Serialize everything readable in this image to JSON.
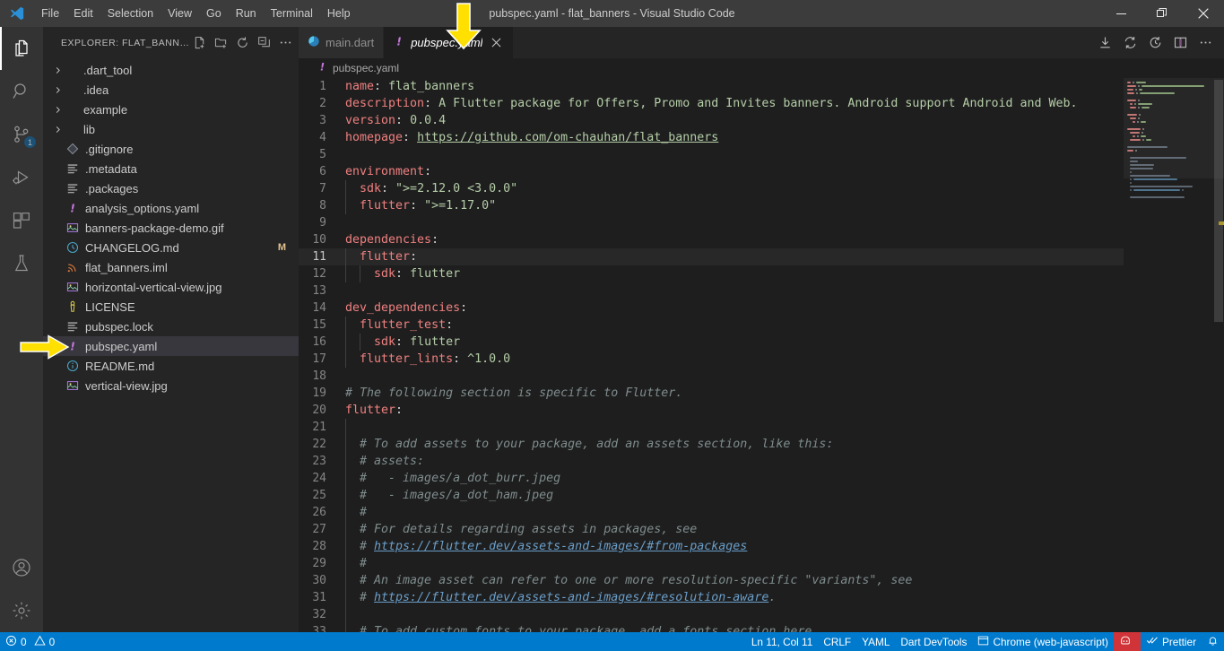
{
  "window": {
    "title": "pubspec.yaml - flat_banners - Visual Studio Code",
    "minimize_label": "Minimize",
    "restore_label": "Restore",
    "close_label": "Close"
  },
  "menu": {
    "items": [
      "File",
      "Edit",
      "Selection",
      "View",
      "Go",
      "Run",
      "Terminal",
      "Help"
    ]
  },
  "activitybar": {
    "items": [
      {
        "name": "explorer",
        "icon": "files-icon",
        "active": true,
        "badge": ""
      },
      {
        "name": "search",
        "icon": "search-icon",
        "active": false,
        "badge": ""
      },
      {
        "name": "source-control",
        "icon": "source-control-icon",
        "active": false,
        "badge": "1"
      },
      {
        "name": "run-and-debug",
        "icon": "run-debug-icon",
        "active": false,
        "badge": ""
      },
      {
        "name": "extensions",
        "icon": "extensions-icon",
        "active": false,
        "badge": ""
      },
      {
        "name": "testing",
        "icon": "beaker-icon",
        "active": false,
        "badge": ""
      }
    ],
    "bottom": [
      {
        "name": "accounts",
        "icon": "account-icon"
      },
      {
        "name": "manage",
        "icon": "gear-icon"
      }
    ]
  },
  "sidebar": {
    "title": "EXPLORER: FLAT_BANN…",
    "actions": [
      "new-file-icon",
      "new-folder-icon",
      "refresh-icon",
      "collapse-all-icon",
      "more-actions-icon"
    ],
    "items": [
      {
        "label": ".dart_tool",
        "kind": "folder",
        "icon": "chevron-right-icon",
        "git": ""
      },
      {
        "label": ".idea",
        "kind": "folder",
        "icon": "chevron-right-icon",
        "git": ""
      },
      {
        "label": "example",
        "kind": "folder",
        "icon": "chevron-right-icon",
        "git": ""
      },
      {
        "label": "lib",
        "kind": "folder",
        "icon": "chevron-right-icon",
        "git": ""
      },
      {
        "label": ".gitignore",
        "kind": "file",
        "icon": "git-icon",
        "git": ""
      },
      {
        "label": ".metadata",
        "kind": "file",
        "icon": "config-icon",
        "git": ""
      },
      {
        "label": ".packages",
        "kind": "file",
        "icon": "config-icon",
        "git": ""
      },
      {
        "label": "analysis_options.yaml",
        "kind": "file",
        "icon": "yaml-icon",
        "git": ""
      },
      {
        "label": "banners-package-demo.gif",
        "kind": "file",
        "icon": "image-icon",
        "git": ""
      },
      {
        "label": "CHANGELOG.md",
        "kind": "file",
        "icon": "changelog-icon",
        "git": "M"
      },
      {
        "label": "flat_banners.iml",
        "kind": "file",
        "icon": "xml-icon",
        "git": ""
      },
      {
        "label": "horizontal-vertical-view.jpg",
        "kind": "file",
        "icon": "image-icon",
        "git": ""
      },
      {
        "label": "LICENSE",
        "kind": "file",
        "icon": "license-icon",
        "git": ""
      },
      {
        "label": "pubspec.lock",
        "kind": "file",
        "icon": "config-icon",
        "git": ""
      },
      {
        "label": "pubspec.yaml",
        "kind": "file",
        "icon": "yaml-icon",
        "git": "",
        "selected": true
      },
      {
        "label": "README.md",
        "kind": "file",
        "icon": "info-icon",
        "git": ""
      },
      {
        "label": "vertical-view.jpg",
        "kind": "file",
        "icon": "image-icon",
        "git": ""
      }
    ]
  },
  "tabs": [
    {
      "label": "main.dart",
      "icon": "dart-icon",
      "active": false
    },
    {
      "label": "pubspec.yaml",
      "icon": "yaml-icon",
      "active": true,
      "close": "×"
    }
  ],
  "editor_actions": [
    "download-icon",
    "sync-icon",
    "run-history-icon",
    "split-editor-icon",
    "more-actions-icon"
  ],
  "breadcrumb": {
    "icon": "yaml-icon",
    "label": "pubspec.yaml"
  },
  "editor": {
    "current_line": 11,
    "lines": [
      {
        "n": 1,
        "indent": 0,
        "tokens": [
          {
            "t": "name",
            "c": "k"
          },
          {
            "t": ": ",
            "c": "punc"
          },
          {
            "t": "flat_banners",
            "c": "v"
          }
        ]
      },
      {
        "n": 2,
        "indent": 0,
        "tokens": [
          {
            "t": "description",
            "c": "k"
          },
          {
            "t": ": ",
            "c": "punc"
          },
          {
            "t": "A Flutter package for Offers, Promo and Invites banners. Android support Android and Web.",
            "c": "v"
          }
        ]
      },
      {
        "n": 3,
        "indent": 0,
        "tokens": [
          {
            "t": "version",
            "c": "k"
          },
          {
            "t": ": ",
            "c": "punc"
          },
          {
            "t": "0.0.4",
            "c": "v"
          }
        ]
      },
      {
        "n": 4,
        "indent": 0,
        "tokens": [
          {
            "t": "homepage",
            "c": "k"
          },
          {
            "t": ": ",
            "c": "punc"
          },
          {
            "t": "https://github.com/om-chauhan/flat_banners",
            "c": "lnk2"
          }
        ]
      },
      {
        "n": 5,
        "indent": 0,
        "tokens": []
      },
      {
        "n": 6,
        "indent": 0,
        "tokens": [
          {
            "t": "environment",
            "c": "k"
          },
          {
            "t": ":",
            "c": "punc"
          }
        ]
      },
      {
        "n": 7,
        "indent": 1,
        "tokens": [
          {
            "t": "  sdk",
            "c": "k"
          },
          {
            "t": ": ",
            "c": "punc"
          },
          {
            "t": "\">=2.12.0 <3.0.0\"",
            "c": "v"
          }
        ]
      },
      {
        "n": 8,
        "indent": 1,
        "tokens": [
          {
            "t": "  flutter",
            "c": "k"
          },
          {
            "t": ": ",
            "c": "punc"
          },
          {
            "t": "\">=1.17.0\"",
            "c": "v"
          }
        ]
      },
      {
        "n": 9,
        "indent": 0,
        "tokens": []
      },
      {
        "n": 10,
        "indent": 0,
        "tokens": [
          {
            "t": "dependencies",
            "c": "k"
          },
          {
            "t": ":",
            "c": "punc"
          }
        ]
      },
      {
        "n": 11,
        "indent": 1,
        "tokens": [
          {
            "t": "  flutter",
            "c": "k"
          },
          {
            "t": ":",
            "c": "punc"
          }
        ]
      },
      {
        "n": 12,
        "indent": 2,
        "tokens": [
          {
            "t": "    sdk",
            "c": "k"
          },
          {
            "t": ": ",
            "c": "punc"
          },
          {
            "t": "flutter",
            "c": "v"
          }
        ]
      },
      {
        "n": 13,
        "indent": 0,
        "tokens": []
      },
      {
        "n": 14,
        "indent": 0,
        "tokens": [
          {
            "t": "dev_dependencies",
            "c": "k"
          },
          {
            "t": ":",
            "c": "punc"
          }
        ]
      },
      {
        "n": 15,
        "indent": 1,
        "tokens": [
          {
            "t": "  flutter_test",
            "c": "k"
          },
          {
            "t": ":",
            "c": "punc"
          }
        ]
      },
      {
        "n": 16,
        "indent": 2,
        "tokens": [
          {
            "t": "    sdk",
            "c": "k"
          },
          {
            "t": ": ",
            "c": "punc"
          },
          {
            "t": "flutter",
            "c": "v"
          }
        ]
      },
      {
        "n": 17,
        "indent": 1,
        "tokens": [
          {
            "t": "  flutter_lints",
            "c": "k"
          },
          {
            "t": ": ",
            "c": "punc"
          },
          {
            "t": "^1.0.0",
            "c": "v"
          }
        ]
      },
      {
        "n": 18,
        "indent": 0,
        "tokens": []
      },
      {
        "n": 19,
        "indent": 0,
        "tokens": [
          {
            "t": "# The following section is specific to Flutter.",
            "c": "cm"
          }
        ]
      },
      {
        "n": 20,
        "indent": 0,
        "tokens": [
          {
            "t": "flutter",
            "c": "k"
          },
          {
            "t": ":",
            "c": "punc"
          }
        ]
      },
      {
        "n": 21,
        "indent": 1,
        "tokens": []
      },
      {
        "n": 22,
        "indent": 1,
        "tokens": [
          {
            "t": "  # To add assets to your package, add an assets section, like this:",
            "c": "cm"
          }
        ]
      },
      {
        "n": 23,
        "indent": 1,
        "tokens": [
          {
            "t": "  # assets:",
            "c": "cm"
          }
        ]
      },
      {
        "n": 24,
        "indent": 1,
        "tokens": [
          {
            "t": "  #   - images/a_dot_burr.jpeg",
            "c": "cm"
          }
        ]
      },
      {
        "n": 25,
        "indent": 1,
        "tokens": [
          {
            "t": "  #   - images/a_dot_ham.jpeg",
            "c": "cm"
          }
        ]
      },
      {
        "n": 26,
        "indent": 1,
        "tokens": [
          {
            "t": "  #",
            "c": "cm"
          }
        ]
      },
      {
        "n": 27,
        "indent": 1,
        "tokens": [
          {
            "t": "  # For details regarding assets in packages, see",
            "c": "cm"
          }
        ]
      },
      {
        "n": 28,
        "indent": 1,
        "tokens": [
          {
            "t": "  # ",
            "c": "cm"
          },
          {
            "t": "https://flutter.dev/assets-and-images/#from-packages",
            "c": "lnk"
          }
        ]
      },
      {
        "n": 29,
        "indent": 1,
        "tokens": [
          {
            "t": "  #",
            "c": "cm"
          }
        ]
      },
      {
        "n": 30,
        "indent": 1,
        "tokens": [
          {
            "t": "  # An image asset can refer to one or more resolution-specific \"variants\", see",
            "c": "cm"
          }
        ]
      },
      {
        "n": 31,
        "indent": 1,
        "tokens": [
          {
            "t": "  # ",
            "c": "cm"
          },
          {
            "t": "https://flutter.dev/assets-and-images/#resolution-aware",
            "c": "lnk"
          },
          {
            "t": ".",
            "c": "cm"
          }
        ]
      },
      {
        "n": 32,
        "indent": 1,
        "tokens": []
      },
      {
        "n": 33,
        "indent": 1,
        "tokens": [
          {
            "t": "  # To add custom fonts to your package, add a fonts section here,",
            "c": "cm"
          }
        ]
      }
    ]
  },
  "statusbar": {
    "left": [
      {
        "name": "problems",
        "icon": "error-icon",
        "label": "0",
        "icon2": "warning-icon",
        "label2": "0"
      }
    ],
    "right": [
      {
        "name": "cursor-position",
        "label": "Ln 11, Col 11"
      },
      {
        "name": "end-of-line",
        "label": "CRLF"
      },
      {
        "name": "language-mode",
        "label": "YAML"
      },
      {
        "name": "dart-devtools",
        "label": "Dart DevTools"
      },
      {
        "name": "browser-target",
        "label": "Chrome (web-javascript)",
        "icon": "browser-icon"
      },
      {
        "name": "live-share",
        "label": "",
        "icon": "live-share-icon",
        "accent": "#d13438"
      },
      {
        "name": "prettier",
        "label": "Prettier",
        "icon": "checkmarks-icon"
      },
      {
        "name": "notifications",
        "label": "",
        "icon": "bell-icon"
      }
    ]
  },
  "annotations": [
    {
      "name": "arrow-down-to-tab",
      "direction": "down",
      "color": "#ffe000"
    },
    {
      "name": "arrow-right-to-file",
      "direction": "right",
      "color": "#ffe000"
    }
  ],
  "colors": {
    "accent": "#007acc",
    "titlebar": "#3c3c3c",
    "activitybar": "#333333",
    "sidebar": "#252526",
    "editor": "#1e1e1e",
    "annotation": "#ffe000"
  }
}
